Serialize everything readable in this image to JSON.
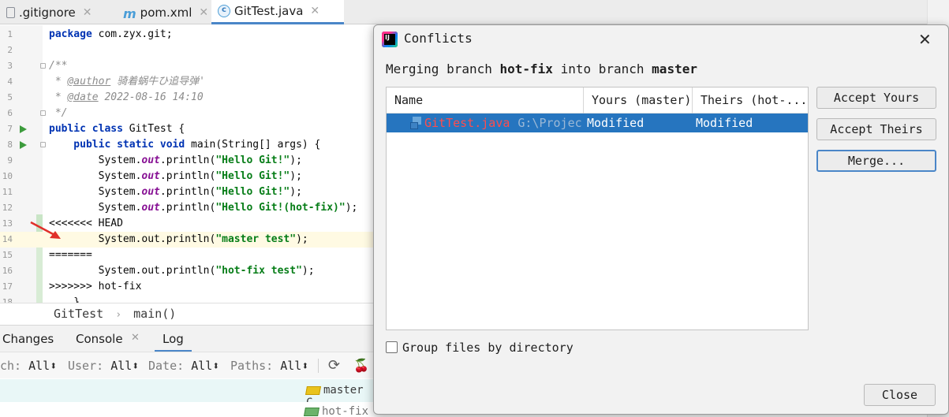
{
  "tabs": [
    {
      "label": ".gitignore",
      "icon": "file-icon"
    },
    {
      "label": "pom.xml",
      "icon": "maven-icon"
    },
    {
      "label": "GitTest.java",
      "icon": "java-class-icon"
    }
  ],
  "editor": {
    "line_numbers": [
      "1",
      "2",
      "3",
      "4",
      "5",
      "6",
      "7",
      "8",
      "9",
      "10",
      "11",
      "12",
      "13",
      "14",
      "15",
      "16",
      "17",
      "18"
    ],
    "lines": [
      {
        "parts": [
          {
            "t": "package ",
            "c": "kw"
          },
          {
            "t": "com.zyx.git;",
            "c": ""
          }
        ]
      },
      {
        "parts": []
      },
      {
        "parts": [
          {
            "t": "/**",
            "c": "cm"
          }
        ]
      },
      {
        "parts": [
          {
            "t": " * ",
            "c": "cm"
          },
          {
            "t": "@author",
            "c": "tag"
          },
          {
            "t": " 骑着蜗牛ひ追导弹'",
            "c": "cm"
          }
        ]
      },
      {
        "parts": [
          {
            "t": " * ",
            "c": "cm"
          },
          {
            "t": "@date",
            "c": "tag"
          },
          {
            "t": " 2022-08-16 14:10",
            "c": "cm"
          }
        ]
      },
      {
        "parts": [
          {
            "t": " */",
            "c": "cm"
          }
        ]
      },
      {
        "parts": [
          {
            "t": "public class ",
            "c": "kw"
          },
          {
            "t": "GitTest {",
            "c": ""
          }
        ]
      },
      {
        "parts": [
          {
            "t": "    public static void ",
            "c": "kw"
          },
          {
            "t": "main(String[] args) {",
            "c": ""
          }
        ]
      },
      {
        "parts": [
          {
            "t": "        System.",
            "c": ""
          },
          {
            "t": "out",
            "c": "fld"
          },
          {
            "t": ".println(",
            "c": ""
          },
          {
            "t": "\"Hello Git!\"",
            "c": "str"
          },
          {
            "t": ");",
            "c": ""
          }
        ]
      },
      {
        "parts": [
          {
            "t": "        System.",
            "c": ""
          },
          {
            "t": "out",
            "c": "fld"
          },
          {
            "t": ".println(",
            "c": ""
          },
          {
            "t": "\"Hello Git!\"",
            "c": "str"
          },
          {
            "t": ");",
            "c": ""
          }
        ]
      },
      {
        "parts": [
          {
            "t": "        System.",
            "c": ""
          },
          {
            "t": "out",
            "c": "fld"
          },
          {
            "t": ".println(",
            "c": ""
          },
          {
            "t": "\"Hello Git!\"",
            "c": "str"
          },
          {
            "t": ");",
            "c": ""
          }
        ]
      },
      {
        "parts": [
          {
            "t": "        System.",
            "c": ""
          },
          {
            "t": "out",
            "c": "fld"
          },
          {
            "t": ".println(",
            "c": ""
          },
          {
            "t": "\"Hello Git!(hot-fix)\"",
            "c": "str"
          },
          {
            "t": ");",
            "c": ""
          }
        ]
      },
      {
        "parts": [
          {
            "t": "<<<<<<< HEAD",
            "c": ""
          }
        ]
      },
      {
        "parts": [
          {
            "t": "        System.out.println(",
            "c": ""
          },
          {
            "t": "\"master test\"",
            "c": "str"
          },
          {
            "t": ");",
            "c": ""
          }
        ]
      },
      {
        "parts": [
          {
            "t": "=======",
            "c": ""
          }
        ]
      },
      {
        "parts": [
          {
            "t": "        System.out.println(",
            "c": ""
          },
          {
            "t": "\"hot-fix test\"",
            "c": "str"
          },
          {
            "t": ");",
            "c": ""
          }
        ]
      },
      {
        "parts": [
          {
            "t": ">>>>>>> hot-fix",
            "c": ""
          }
        ]
      },
      {
        "parts": [
          {
            "t": "    }",
            "c": ""
          }
        ]
      }
    ]
  },
  "breadcrumb": {
    "class_name": "GitTest",
    "separator": "›",
    "method": "main()"
  },
  "tool_window": {
    "tabs": [
      {
        "label": "Changes"
      },
      {
        "label": "Console"
      },
      {
        "label": "Log"
      }
    ],
    "filters": [
      {
        "label": "ch:",
        "value": "All"
      },
      {
        "label": "User:",
        "value": "All"
      },
      {
        "label": "Date:",
        "value": "All"
      },
      {
        "label": "Paths:",
        "value": "All"
      }
    ],
    "log_rows": [
      {
        "branch": "master",
        "trailing": "C"
      },
      {
        "branch": "hot-fix",
        "trailing": ""
      }
    ]
  },
  "dialog": {
    "title": "Conflicts",
    "message_prefix": "Merging branch ",
    "source_branch": "hot-fix",
    "message_middle": " into branch ",
    "target_branch": "master",
    "table": {
      "columns": [
        "Name",
        "Yours (master)",
        "Theirs (hot-..."
      ],
      "rows": [
        {
          "name": "GitTest.java",
          "path": "G:\\Projec",
          "yours": "Modified",
          "theirs": "Modified"
        }
      ]
    },
    "buttons": {
      "accept_yours": "Accept Yours",
      "accept_theirs": "Accept Theirs",
      "merge": "Merge...",
      "close": "Close"
    },
    "group_checkbox": {
      "label": "Group files by directory",
      "checked": false
    }
  },
  "colors": {
    "accent": "#4a86c8",
    "selection": "#2675bf",
    "conflict_file": "#ff4d4d"
  }
}
